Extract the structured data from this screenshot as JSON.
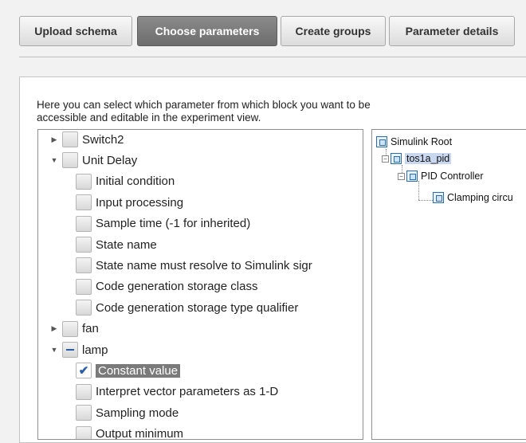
{
  "tabs": [
    {
      "label": "Upload schema",
      "active": false
    },
    {
      "label": "Choose parameters",
      "active": true
    },
    {
      "label": "Create groups",
      "active": false
    },
    {
      "label": "Parameter details",
      "active": false
    }
  ],
  "description": "Here you can select which parameter from which block you want to be accessible and editable in the experiment view.",
  "left_tree": {
    "rows": [
      {
        "label": "Switch2",
        "level": 0,
        "expander": "collapsed",
        "check": "unchecked"
      },
      {
        "label": "Unit Delay",
        "level": 0,
        "expander": "expanded",
        "check": "unchecked"
      },
      {
        "label": "Initial condition",
        "level": 1,
        "check": "unchecked"
      },
      {
        "label": "Input processing",
        "level": 1,
        "check": "unchecked"
      },
      {
        "label": "Sample time (-1 for inherited)",
        "level": 1,
        "check": "unchecked"
      },
      {
        "label": "State name",
        "level": 1,
        "check": "unchecked"
      },
      {
        "label": "State name must resolve to Simulink sigr",
        "level": 1,
        "check": "unchecked"
      },
      {
        "label": "Code generation storage class",
        "level": 1,
        "check": "unchecked"
      },
      {
        "label": "Code generation storage type qualifier",
        "level": 1,
        "check": "unchecked"
      },
      {
        "label": "fan",
        "level": 0,
        "expander": "collapsed",
        "check": "unchecked"
      },
      {
        "label": "lamp",
        "level": 0,
        "expander": "expanded",
        "check": "partial"
      },
      {
        "label": "Constant value",
        "level": 1,
        "check": "checked",
        "selected": true
      },
      {
        "label": "Interpret vector parameters as 1-D",
        "level": 1,
        "check": "unchecked"
      },
      {
        "label": "Sampling mode",
        "level": 1,
        "check": "unchecked"
      },
      {
        "label": "Output minimum",
        "level": 1,
        "check": "unchecked"
      }
    ],
    "scrollbar_up_icon": "up-arrow-icon"
  },
  "right_tree": {
    "nodes": [
      {
        "label": "Simulink Root",
        "icon": "simulink-root-icon"
      },
      {
        "label": "tos1a_pid",
        "icon": "model-icon",
        "selected": true
      },
      {
        "label": "PID Controller",
        "icon": "subsystem-icon"
      },
      {
        "label": "Clamping circu",
        "icon": "subsystem-icon"
      }
    ]
  }
}
